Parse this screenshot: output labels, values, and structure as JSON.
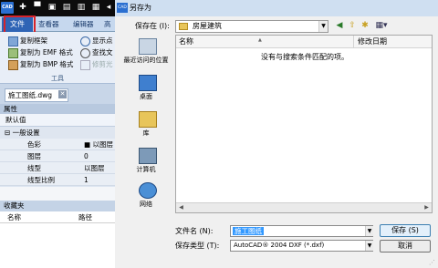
{
  "cad": {
    "logo_text": "CAD",
    "tabs": [
      "文件",
      "查看器",
      "编辑器",
      "高"
    ],
    "ribbon": {
      "col1": [
        "复制框架",
        "复制为 EMF 格式",
        "复制为 BMP 格式"
      ],
      "col2": [
        "显示点",
        "查找文",
        "修剪光"
      ],
      "group_label": "工具"
    },
    "document_tab": "施工图纸.dwg",
    "properties": {
      "header": "属性",
      "default_label": "默认值",
      "group_label": "一般设置",
      "rows": [
        {
          "key": "色彩",
          "value": "■ 以图层"
        },
        {
          "key": "图层",
          "value": "0"
        },
        {
          "key": "线型",
          "value": "以图层"
        },
        {
          "key": "线型比例",
          "value": "1"
        }
      ]
    },
    "favorites": {
      "header": "收藏夹",
      "col_name": "名称",
      "col_path": "路径"
    }
  },
  "dialog": {
    "title": "另存为",
    "title_icon_text": "CAD",
    "save_in_label": "保存在 (I):",
    "save_in_value": "房屋建筑",
    "places": [
      "最近访问的位置",
      "桌面",
      "库",
      "计算机",
      "网络"
    ],
    "column_name": "名称",
    "column_modified": "修改日期",
    "empty_message": "没有与搜索条件匹配的项。",
    "filename_label": "文件名 (N):",
    "filename_value": "施工图纸",
    "filetype_label": "保存类型 (T):",
    "filetype_value": "AutoCAD® 2004 DXF (*.dxf)",
    "save_button": "保存 (S)",
    "cancel_button": "取消"
  }
}
